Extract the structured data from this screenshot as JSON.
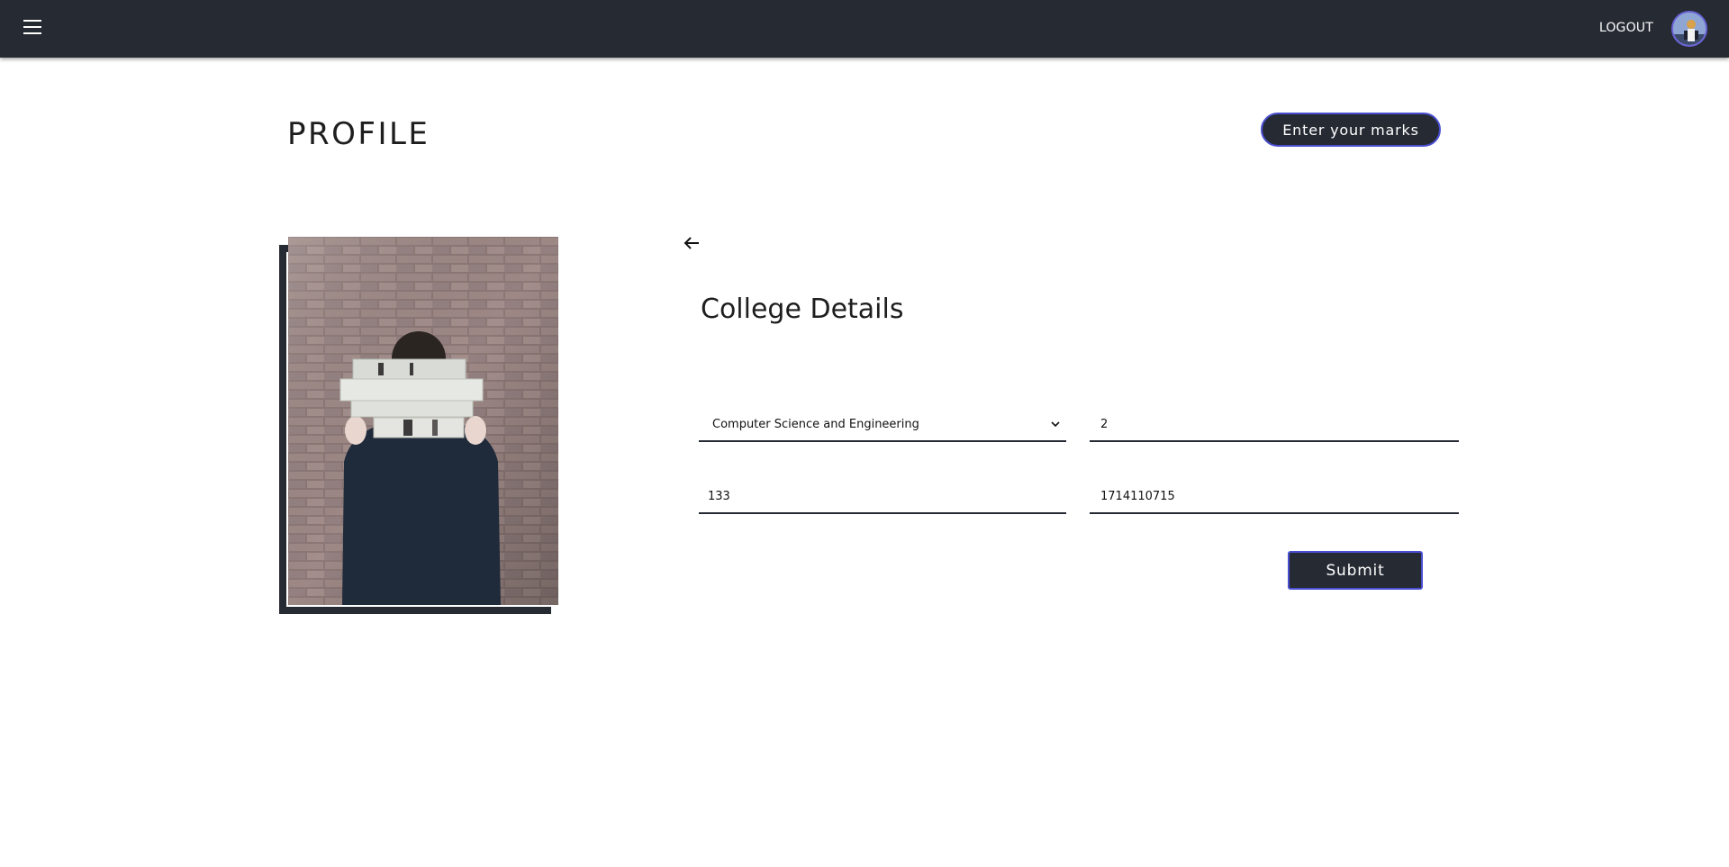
{
  "topbar": {
    "menu_icon": "hamburger-menu-icon",
    "logout_label": "LOGOUT",
    "avatar_icon": "user-avatar"
  },
  "header": {
    "title": "PROFILE",
    "marks_button_label": "Enter your marks"
  },
  "form": {
    "back_icon": "arrow-left-icon",
    "title": "College Details",
    "department": "Computer Science and Engineering",
    "semester": "2",
    "roll_number": "133",
    "register_number": "1714110715",
    "submit_label": "Submit"
  },
  "colors": {
    "navbar": "#262a33",
    "accent_border": "#4a4fd1",
    "background": "#ffffff"
  }
}
